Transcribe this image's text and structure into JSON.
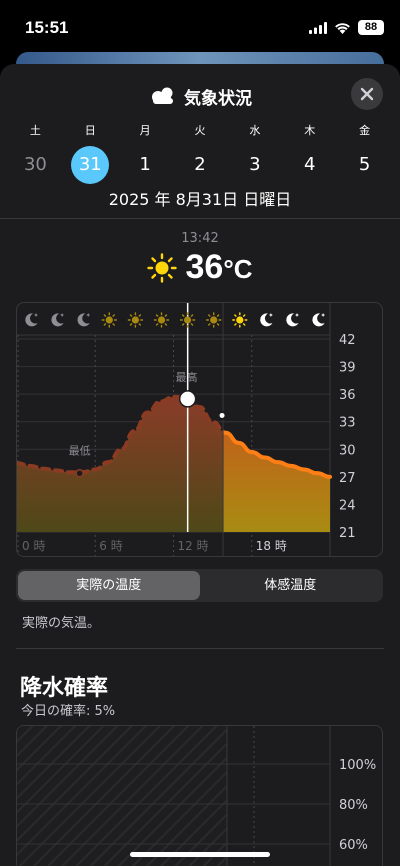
{
  "status": {
    "time": "15:51",
    "battery": "88"
  },
  "header": {
    "title": "気象状況",
    "icon": "cloud-icon",
    "close_icon": "close-icon"
  },
  "week": [
    {
      "dow": "土",
      "date": "30",
      "state": "past"
    },
    {
      "dow": "日",
      "date": "31",
      "state": "selected"
    },
    {
      "dow": "月",
      "date": "1",
      "state": "future"
    },
    {
      "dow": "火",
      "date": "2",
      "state": "future"
    },
    {
      "dow": "水",
      "date": "3",
      "state": "future"
    },
    {
      "dow": "木",
      "date": "4",
      "state": "future"
    },
    {
      "dow": "金",
      "date": "5",
      "state": "future"
    }
  ],
  "full_date": "2025 年 8月31日 日曜日",
  "current": {
    "time": "13:42",
    "temp": "36",
    "unit": "°C",
    "icon": "sun-icon"
  },
  "chart_data": {
    "type": "area",
    "x_tick_labels": [
      "0 時",
      "6 時",
      "12 時",
      "18 時"
    ],
    "y_tick_labels": [
      "42",
      "39",
      "36",
      "33",
      "30",
      "27",
      "24",
      "21"
    ],
    "ylim": [
      21,
      42
    ],
    "xlim": [
      0,
      24
    ],
    "hourly_icons": [
      "moon-icon",
      "moon-icon",
      "moon-icon",
      "sun-icon",
      "sun-icon",
      "sun-icon",
      "sun-icon",
      "sun-icon",
      "sun-icon",
      "moon-icon",
      "moon-icon",
      "moon-icon"
    ],
    "series": [
      {
        "values": [
          [
            0,
            28.5
          ],
          [
            1,
            28.2
          ],
          [
            2,
            27.9
          ],
          [
            3,
            27.7
          ],
          [
            4,
            27.5
          ],
          [
            5,
            27.5
          ],
          [
            6,
            27.8
          ],
          [
            7,
            28.6
          ],
          [
            8,
            30.0
          ],
          [
            9,
            32.0
          ],
          [
            10,
            34.0
          ],
          [
            11,
            35.2
          ],
          [
            12,
            35.7
          ],
          [
            13,
            35.6
          ],
          [
            14,
            34.6
          ],
          [
            15,
            33.0
          ],
          [
            16,
            31.8
          ],
          [
            17,
            30.7
          ],
          [
            18,
            29.7
          ],
          [
            19,
            29.1
          ],
          [
            20,
            28.6
          ],
          [
            21,
            28.2
          ],
          [
            22,
            27.8
          ],
          [
            23,
            27.4
          ],
          [
            24,
            27.0
          ]
        ]
      }
    ],
    "now_x": 13.7,
    "markers": [
      {
        "label": "最低",
        "x": 4.8,
        "y": 27.5
      },
      {
        "label": "最高",
        "x": 13.0,
        "y": 35.7
      }
    ]
  },
  "segment": {
    "options": [
      "実際の温度",
      "体感温度"
    ],
    "selected": 0
  },
  "description": "実際の気温。",
  "precip": {
    "title": "降水確率",
    "subtitle": "今日の確率: 5%",
    "y_tick_labels": [
      "100%",
      "80%",
      "60%"
    ]
  },
  "colors": {
    "accent": "#5ac8fa",
    "temp_line": "#ff7f17",
    "sun": "#ffd60a"
  }
}
